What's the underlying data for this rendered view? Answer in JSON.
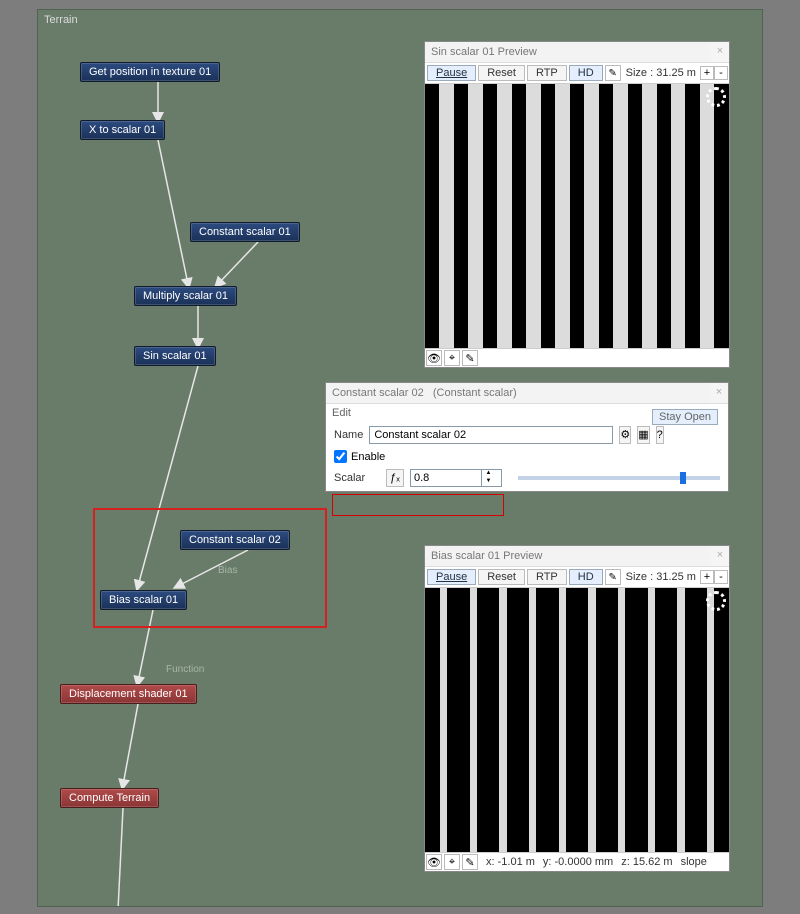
{
  "canvas": {
    "title": "Terrain"
  },
  "nodes": {
    "get_pos": "Get position in texture 01",
    "x_to_scalar": "X to scalar 01",
    "const1": "Constant scalar 01",
    "multiply": "Multiply scalar 01",
    "sin": "Sin scalar 01",
    "const2": "Constant scalar 02",
    "bias": "Bias scalar 01",
    "displace": "Displacement shader 01",
    "compute": "Compute Terrain"
  },
  "link_labels": {
    "bias": "Bias",
    "function": "Function"
  },
  "preview1": {
    "title": "Sin scalar 01 Preview",
    "pause": "Pause",
    "reset": "Reset",
    "rtp": "RTP",
    "hd": "HD",
    "size": "Size : 31.25 m",
    "plus": "+",
    "minus": "-"
  },
  "preview2": {
    "title": "Bias scalar 01 Preview",
    "pause": "Pause",
    "reset": "Reset",
    "rtp": "RTP",
    "hd": "HD",
    "size": "Size : 31.25 m",
    "plus": "+",
    "minus": "-",
    "coords": {
      "x": "x: -1.01 m",
      "y": "y: -0.0000 mm",
      "z": "z: 15.62 m",
      "slope": "slope"
    }
  },
  "editor": {
    "title_main": "Constant scalar 02",
    "title_type": "(Constant scalar)",
    "edit": "Edit",
    "stay_open": "Stay Open",
    "name_lbl": "Name",
    "name_val": "Constant scalar 02",
    "enable": "Enable",
    "scalar_lbl": "Scalar",
    "scalar_val": "0.8",
    "gear": "⚙",
    "pal": "▦",
    "q": "?"
  },
  "icons": {
    "eye": "👁",
    "target": "⌖",
    "pencil": "✎",
    "fx": "ƒₓ"
  }
}
